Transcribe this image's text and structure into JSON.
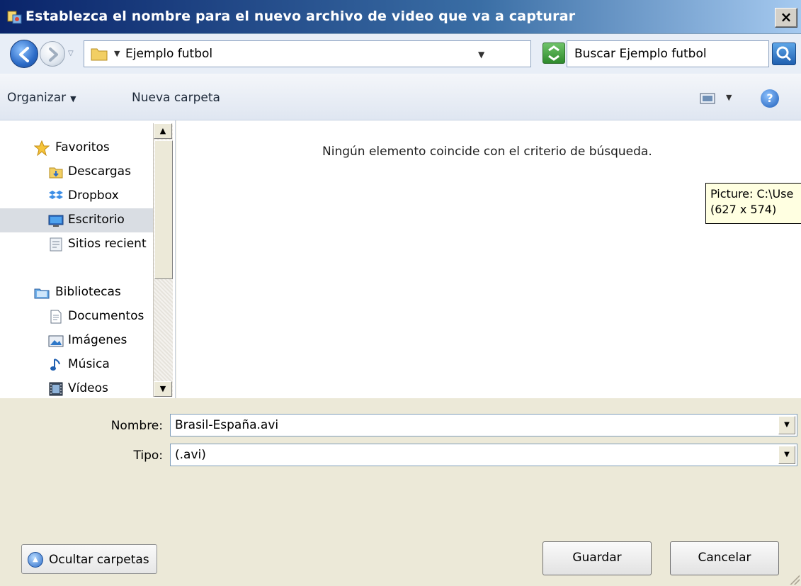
{
  "window": {
    "title": "Establezca el nombre para el nuevo archivo de video que va a capturar",
    "close_label": "×"
  },
  "address": {
    "path": "Ejemplo futbol",
    "search_placeholder": "Buscar Ejemplo futbol"
  },
  "toolbar": {
    "organize_label": "Organizar",
    "new_folder_label": "Nueva carpeta"
  },
  "nav": {
    "favorites": [
      {
        "label": "Favoritos",
        "icon": "star-icon"
      },
      {
        "label": "Descargas",
        "icon": "downloads-folder-icon"
      },
      {
        "label": "Dropbox",
        "icon": "dropbox-icon"
      },
      {
        "label": "Escritorio",
        "icon": "desktop-icon",
        "selected": true
      },
      {
        "label": "Sitios recient",
        "icon": "recent-places-icon"
      }
    ],
    "libraries": [
      {
        "label": "Bibliotecas",
        "icon": "libraries-icon"
      },
      {
        "label": "Documentos",
        "icon": "documents-icon"
      },
      {
        "label": "Imágenes",
        "icon": "pictures-icon"
      },
      {
        "label": "Música",
        "icon": "music-icon"
      },
      {
        "label": "Vídeos",
        "icon": "videos-icon"
      }
    ]
  },
  "content": {
    "empty_message": "Ningún elemento coincide con el criterio de búsqueda."
  },
  "tooltip": {
    "line1": "Picture: C:\\Use",
    "line2": "(627 x 574)"
  },
  "form": {
    "name_label": "Nombre:",
    "name_value": "Brasil-España.avi",
    "type_label": "Tipo:",
    "type_value": "(.avi)"
  },
  "buttons": {
    "hide_folders": "Ocultar carpetas",
    "save": "Guardar",
    "cancel": "Cancelar"
  },
  "colors": {
    "title_bar": "#0a246a",
    "selected_item": "#d9dde3",
    "tooltip_bg": "#ffffe1"
  }
}
